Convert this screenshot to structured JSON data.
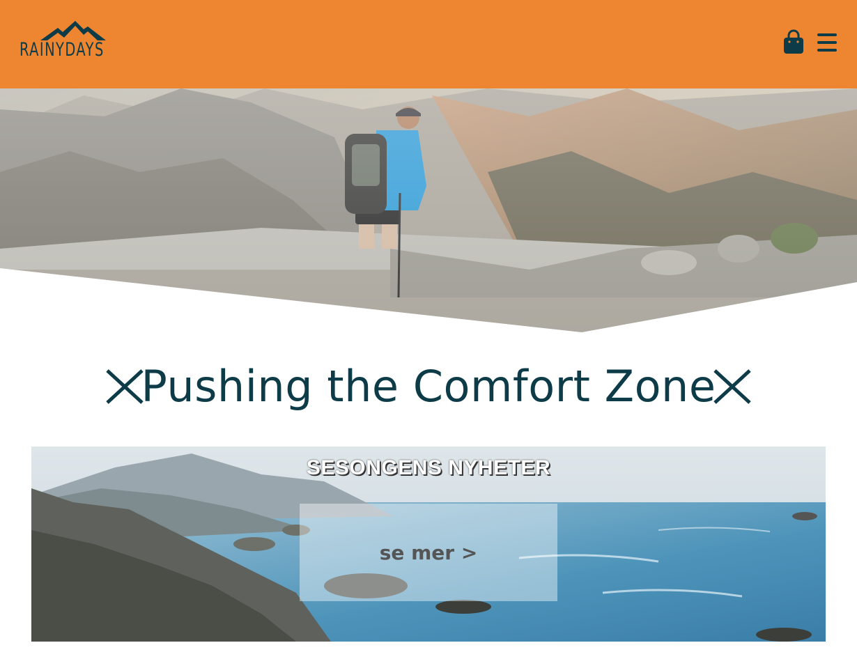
{
  "colors": {
    "brand_orange": "#ee8530",
    "brand_teal": "#0d3b48"
  },
  "header": {
    "logo_text": "RAINYDAYS",
    "cart_icon": "shopping-bag-icon",
    "menu_icon": "hamburger-menu-icon"
  },
  "hero": {
    "image": "hiker-on-mountain-ridge"
  },
  "headline": {
    "text": "Pushing the Comfort Zone",
    "decoration_icon": "cross-icon"
  },
  "promo": {
    "image": "rocky-coastline-ocean",
    "title": "SESONGENS NYHETER",
    "cta_label": "se mer >"
  }
}
